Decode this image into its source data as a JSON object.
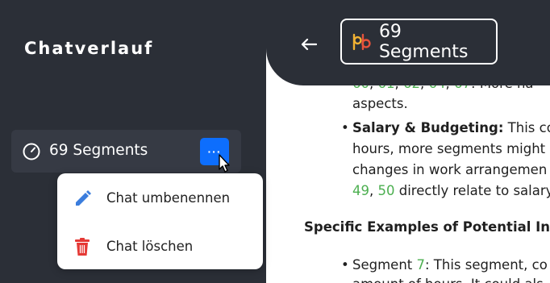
{
  "sidebar": {
    "title": "Chatverlauf",
    "chat_item": {
      "label": "69 Segments",
      "more_label": "···"
    }
  },
  "menu": {
    "rename_label": "Chat umbenennen",
    "delete_label": "Chat löschen"
  },
  "header": {
    "title": "69 Segments"
  },
  "content": {
    "partial_line_numbers": [
      "60",
      "61",
      "62",
      "64",
      "67"
    ],
    "partial_line_text": "More ha",
    "aspects": "aspects.",
    "salary_heading": "Salary & Budgeting:",
    "salary_text1": " This co",
    "salary_text2": "hours, more segments might",
    "salary_text3": "changes in work arrangemen",
    "salary_num1": "49",
    "salary_sep": ", ",
    "salary_num2": "50",
    "salary_text4": " directly relate to salary",
    "examples_heading": "Specific Examples of Potential Inc",
    "segment_prefix": "Segment ",
    "segment_num": "7",
    "segment_text": ": This segment, co",
    "cut_line": "amount of hours. It could als"
  },
  "colors": {
    "sidebar_bg": "#2b2f37",
    "accent_blue": "#0d6efd",
    "link_green": "#4caf50",
    "delete_red": "#e53935"
  }
}
